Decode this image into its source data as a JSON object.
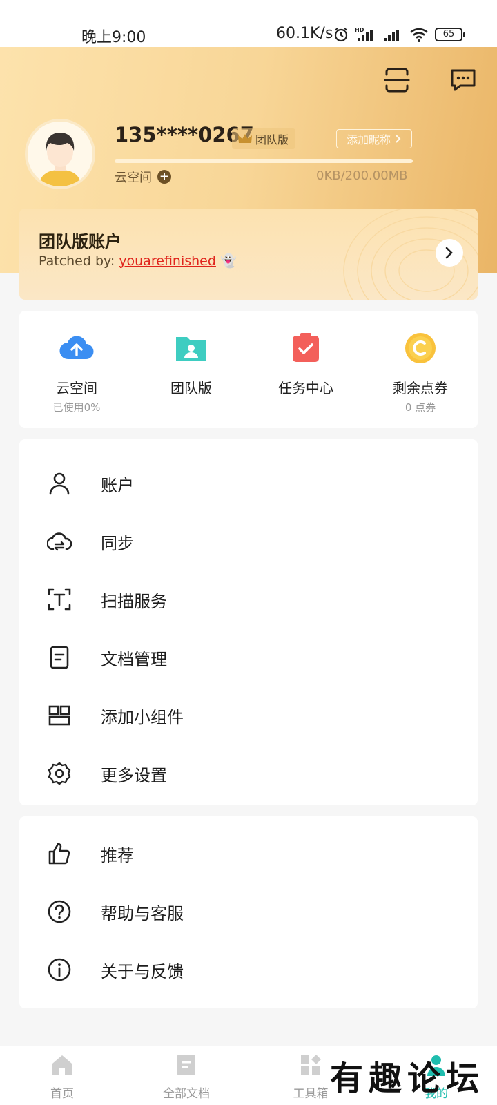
{
  "status_bar": {
    "time": "晚上9:00",
    "net_speed": "60.1K/s",
    "battery": "65"
  },
  "header": {
    "scan_icon": "scan-icon",
    "message_icon": "message-icon",
    "phone": "135****0267",
    "badge": "团队版",
    "nickname_button": "添加昵称",
    "space_label": "云空间",
    "space_usage": "0KB/200.00MB",
    "space_used_fraction": 0
  },
  "team_card": {
    "title": "团队版账户",
    "patched_prefix": "Patched by:",
    "patched_link": "youarefinished",
    "emoji": "👻"
  },
  "quick": [
    {
      "label": "云空间",
      "sub": "已使用0%",
      "icon": "cloud-upload-icon",
      "color": "#3b8ef2"
    },
    {
      "label": "团队版",
      "sub": "",
      "icon": "team-folder-icon",
      "color": "#3ecdc1"
    },
    {
      "label": "任务中心",
      "sub": "",
      "icon": "task-check-icon",
      "color": "#f35f5a"
    },
    {
      "label": "剩余点券",
      "sub": "0 点券",
      "icon": "coin-icon",
      "color": "#f9c23c"
    }
  ],
  "menu": [
    {
      "label": "账户",
      "icon": "user-icon"
    },
    {
      "label": "同步",
      "icon": "cloud-sync-icon"
    },
    {
      "label": "扫描服务",
      "icon": "scan-text-icon"
    },
    {
      "label": "文档管理",
      "icon": "document-icon"
    },
    {
      "label": "添加小组件",
      "icon": "widget-icon"
    },
    {
      "label": "更多设置",
      "icon": "gear-icon"
    }
  ],
  "menu2": [
    {
      "label": "推荐",
      "icon": "thumbs-up-icon"
    },
    {
      "label": "帮助与客服",
      "icon": "help-icon"
    },
    {
      "label": "关于与反馈",
      "icon": "info-icon"
    }
  ],
  "tabs": [
    {
      "label": "首页",
      "icon": "home-icon"
    },
    {
      "label": "全部文档",
      "icon": "docs-icon"
    },
    {
      "label": "工具箱",
      "icon": "toolbox-icon"
    },
    {
      "label": "我的",
      "icon": "profile-icon",
      "active": true
    }
  ],
  "watermark": "有趣论坛",
  "colors": {
    "accent": "#1fbdae",
    "header_gradient_start": "#fde3ad",
    "header_gradient_end": "#eab566",
    "link": "#e0241c"
  }
}
